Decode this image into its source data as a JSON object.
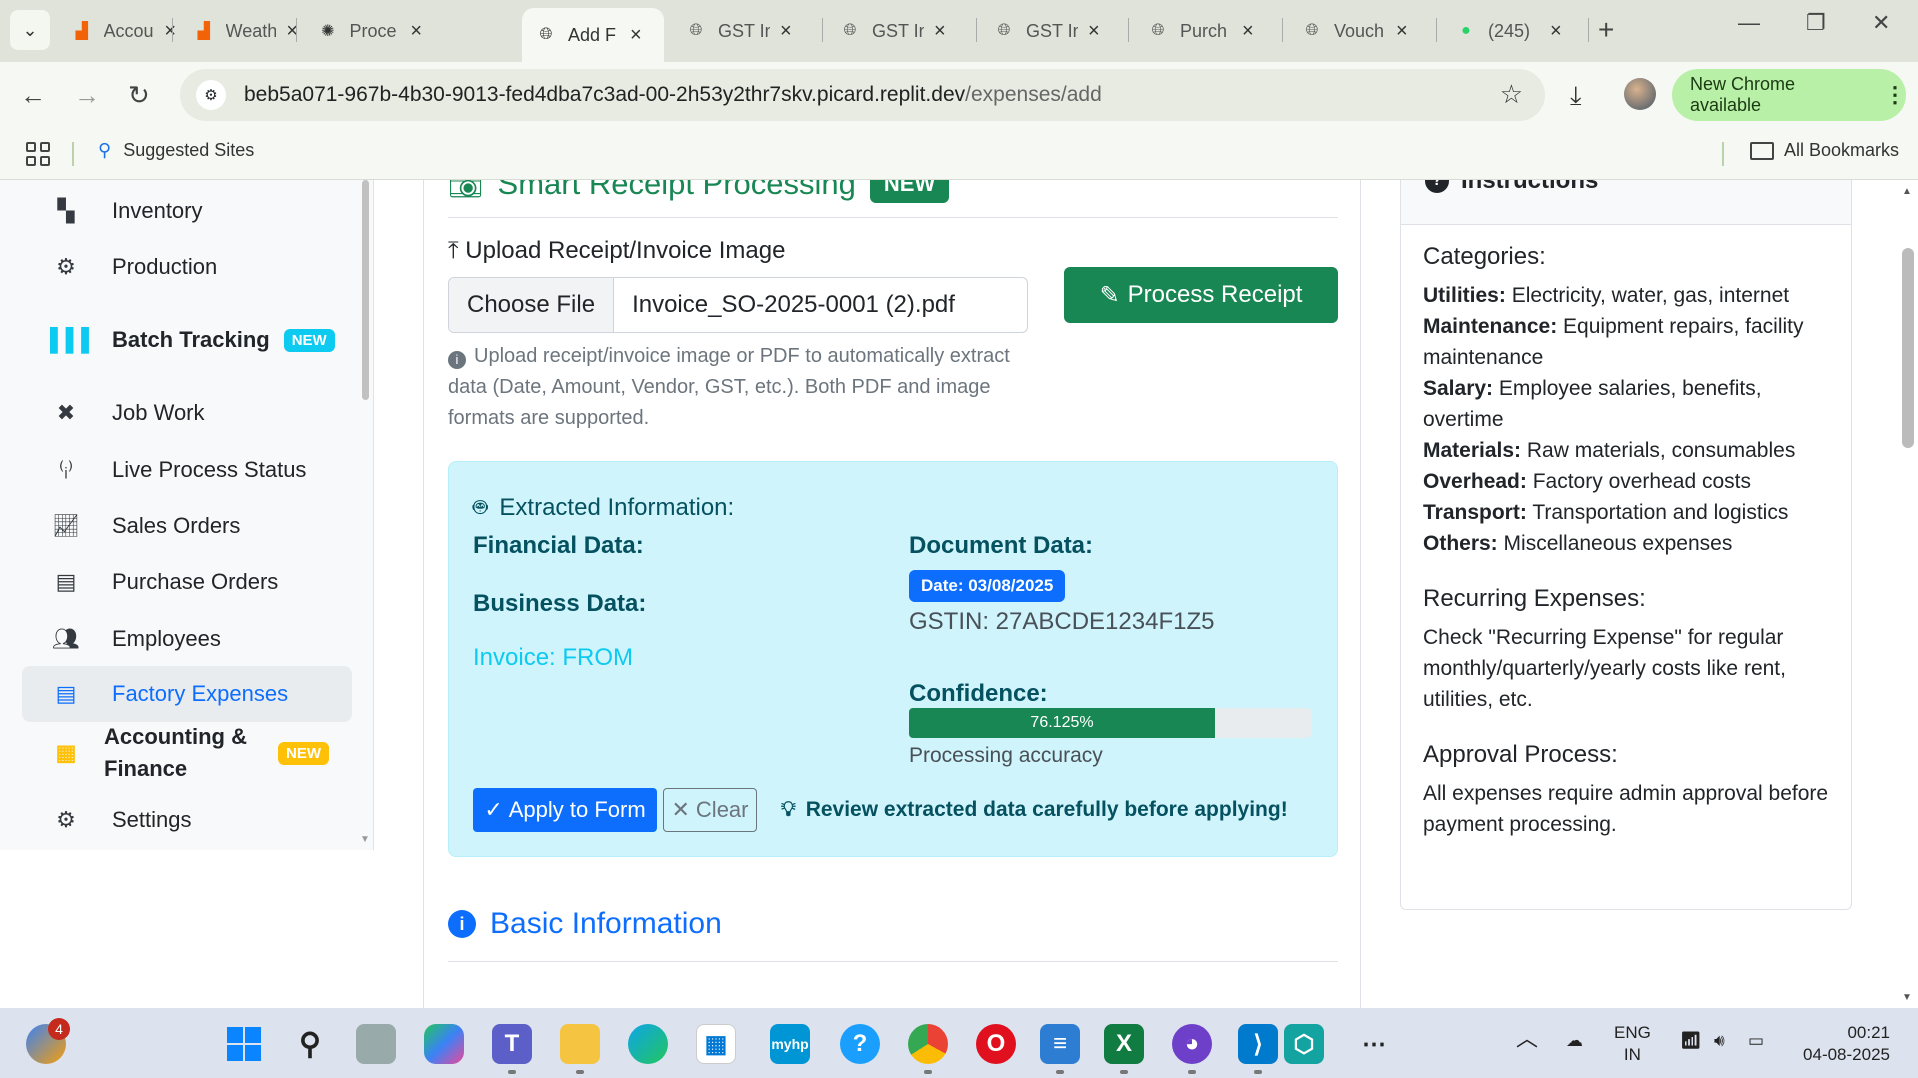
{
  "browser": {
    "tabs": [
      {
        "title": "Accou",
        "icon": "replit-icon"
      },
      {
        "title": "Weath",
        "icon": "replit-icon"
      },
      {
        "title": "Proce",
        "icon": "openai-icon"
      },
      {
        "title": "Add F",
        "icon": "globe-icon",
        "active": true
      },
      {
        "title": "GST In",
        "icon": "globe-icon"
      },
      {
        "title": "GST In",
        "icon": "globe-icon"
      },
      {
        "title": "GST In",
        "icon": "globe-icon"
      },
      {
        "title": "Purch",
        "icon": "globe-icon"
      },
      {
        "title": "Vouch",
        "icon": "globe-icon"
      },
      {
        "title": "(245)",
        "icon": "whatsapp-icon"
      }
    ],
    "url_host": "beb5a071-967b-4b30-9013-fed4dba7c3ad-00-2h53y2thr7skv.picard.replit.dev",
    "url_path": "/expenses/add",
    "new_chrome": "New Chrome available",
    "suggested_sites": "Suggested Sites",
    "all_bookmarks": "All Bookmarks"
  },
  "sidebar": {
    "items": [
      {
        "label": "Inventory",
        "icon": "boxes-icon"
      },
      {
        "label": "Production",
        "icon": "cogs-icon"
      },
      {
        "label": "Batch Tracking",
        "icon": "barcode-icon",
        "badge": "NEW"
      },
      {
        "label": "Job Work",
        "icon": "tools-icon"
      },
      {
        "label": "Live Process Status",
        "icon": "broadcast-icon"
      },
      {
        "label": "Sales Orders",
        "icon": "chart-line-icon"
      },
      {
        "label": "Purchase Orders",
        "icon": "file-invoice-icon"
      },
      {
        "label": "Employees",
        "icon": "users-icon"
      },
      {
        "label": "Factory Expenses",
        "icon": "receipt-icon",
        "active": true
      },
      {
        "label": "Accounting & Finance",
        "icon": "calculator-icon",
        "badge": "NEW"
      },
      {
        "label": "Settings",
        "icon": "gear-icon"
      }
    ]
  },
  "receipt": {
    "title": "Smart Receipt Processing",
    "badge": "NEW",
    "upload_label": "Upload Receipt/Invoice Image",
    "choose_file": "Choose File",
    "file_name": "Invoice_SO-2025-0001 (2).pdf",
    "process_button": "Process Receipt",
    "help_text": "Upload receipt/invoice image or PDF to automatically extract data (Date, Amount, Vendor, GST, etc.). Both PDF and image formats are supported."
  },
  "extracted": {
    "title": "Extracted Information:",
    "financial_heading": "Financial Data:",
    "business_heading": "Business Data:",
    "invoice_text": "Invoice: FROM",
    "document_heading": "Document Data:",
    "date_badge": "Date: 03/08/2025",
    "gstin": "GSTIN: 27ABCDE1234F1Z5",
    "confidence_heading": "Confidence:",
    "confidence_label": "76.125%",
    "confidence_value": 0.76125,
    "accuracy_text": "Processing accuracy",
    "apply_button": "Apply to Form",
    "clear_button": "Clear",
    "review_note": "Review extracted data carefully before applying!"
  },
  "basic": {
    "title": "Basic Information"
  },
  "instructions": {
    "title": "Instructions",
    "categories_heading": "Categories:",
    "categories": [
      {
        "name": "Utilities:",
        "desc": "Electricity, water, gas, internet"
      },
      {
        "name": "Maintenance:",
        "desc": "Equipment repairs, facility maintenance"
      },
      {
        "name": "Salary:",
        "desc": "Employee salaries, benefits, overtime"
      },
      {
        "name": "Materials:",
        "desc": "Raw materials, consumables"
      },
      {
        "name": "Overhead:",
        "desc": "Factory overhead costs"
      },
      {
        "name": "Transport:",
        "desc": "Transportation and logistics"
      },
      {
        "name": "Others:",
        "desc": "Miscellaneous expenses"
      }
    ],
    "recurring_heading": "Recurring Expenses:",
    "recurring_text": "Check \"Recurring Expense\" for regular monthly/quarterly/yearly costs like rent, utilities, etc.",
    "approval_heading": "Approval Process:",
    "approval_text": "All expenses require admin approval before payment processing."
  },
  "taskbar": {
    "notification_count": "4",
    "lang_top": "ENG",
    "lang_bottom": "IN",
    "time": "00:21",
    "date": "04-08-2025"
  }
}
